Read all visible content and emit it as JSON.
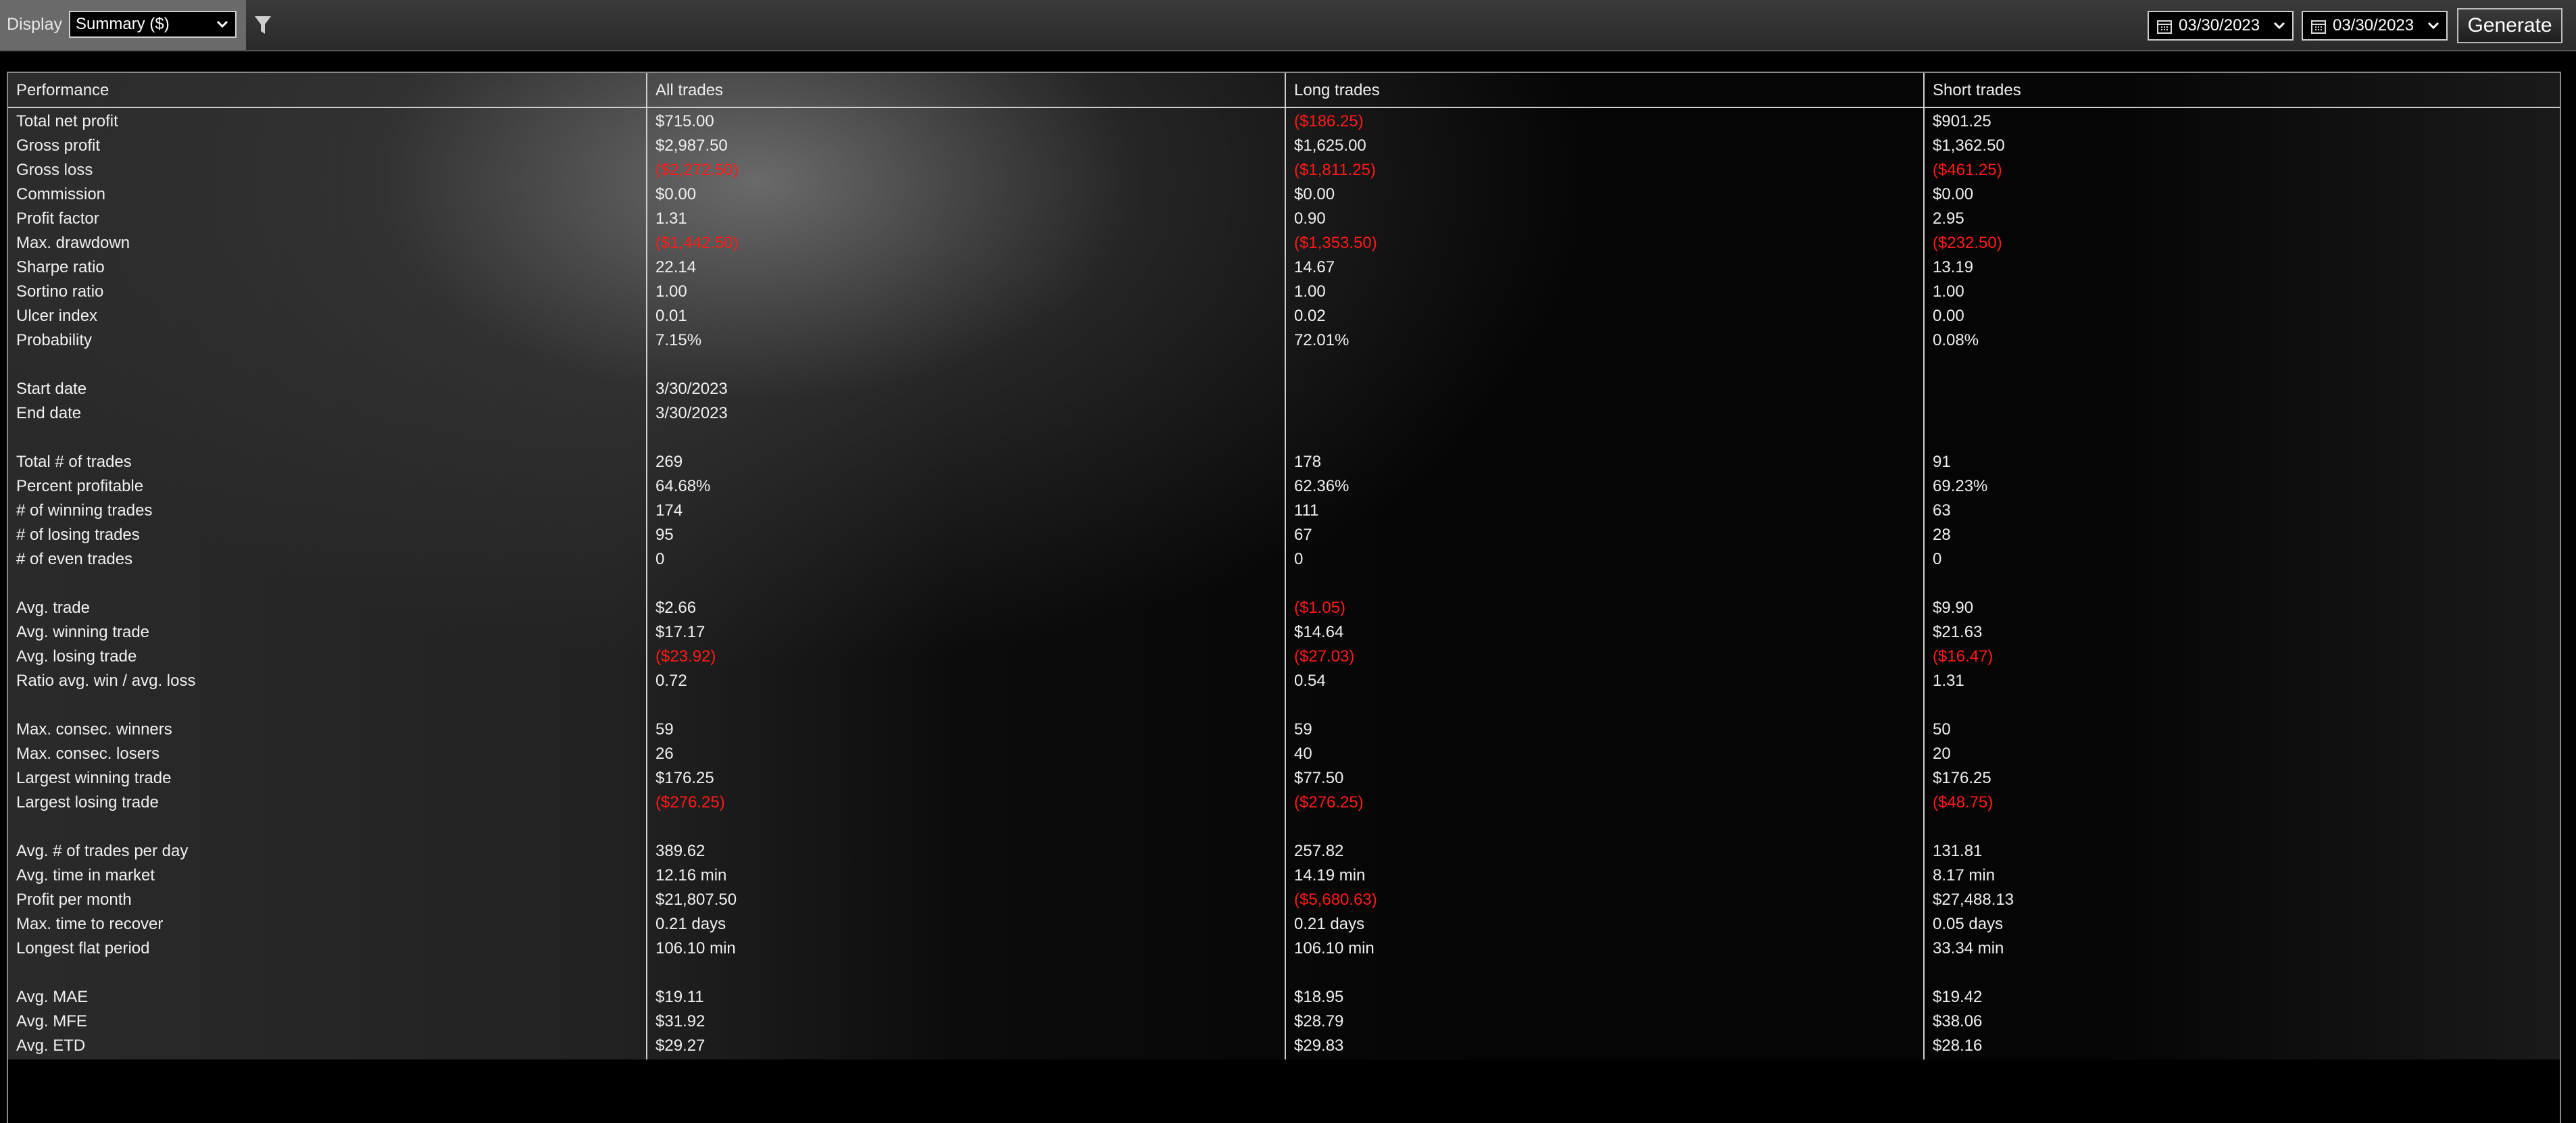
{
  "toolbar": {
    "display_label": "Display",
    "display_value": "Summary ($)",
    "date_from": "03/30/2023",
    "date_to": "03/30/2023",
    "generate_label": "Generate"
  },
  "colors": {
    "negative": "#ff1a1a",
    "text": "#f0f0f0",
    "grid": "#cfcfcf"
  },
  "table": {
    "headers": [
      "Performance",
      "All trades",
      "Long trades",
      "Short trades"
    ],
    "rows": [
      {
        "label": "Total net profit",
        "all": "$715.00",
        "long": "($186.25)",
        "short": "$901.25",
        "neg": [
          false,
          true,
          false
        ]
      },
      {
        "label": "Gross profit",
        "all": "$2,987.50",
        "long": "$1,625.00",
        "short": "$1,362.50",
        "neg": [
          false,
          false,
          false
        ]
      },
      {
        "label": "Gross loss",
        "all": "($2,272.50)",
        "long": "($1,811.25)",
        "short": "($461.25)",
        "neg": [
          true,
          true,
          true
        ]
      },
      {
        "label": "Commission",
        "all": "$0.00",
        "long": "$0.00",
        "short": "$0.00",
        "neg": [
          false,
          false,
          false
        ]
      },
      {
        "label": "Profit factor",
        "all": "1.31",
        "long": "0.90",
        "short": "2.95",
        "neg": [
          false,
          false,
          false
        ]
      },
      {
        "label": "Max. drawdown",
        "all": "($1,442.50)",
        "long": "($1,353.50)",
        "short": "($232.50)",
        "neg": [
          true,
          true,
          true
        ]
      },
      {
        "label": "Sharpe ratio",
        "all": "22.14",
        "long": "14.67",
        "short": "13.19",
        "neg": [
          false,
          false,
          false
        ]
      },
      {
        "label": "Sortino ratio",
        "all": "1.00",
        "long": "1.00",
        "short": "1.00",
        "neg": [
          false,
          false,
          false
        ]
      },
      {
        "label": "Ulcer index",
        "all": "0.01",
        "long": "0.02",
        "short": "0.00",
        "neg": [
          false,
          false,
          false
        ]
      },
      {
        "label": "Probability",
        "all": "7.15%",
        "long": "72.01%",
        "short": "0.08%",
        "neg": [
          false,
          false,
          false
        ]
      },
      {
        "spacer": true
      },
      {
        "label": "Start date",
        "all": "3/30/2023",
        "long": "",
        "short": "",
        "neg": [
          false,
          false,
          false
        ]
      },
      {
        "label": "End date",
        "all": "3/30/2023",
        "long": "",
        "short": "",
        "neg": [
          false,
          false,
          false
        ]
      },
      {
        "spacer": true
      },
      {
        "label": "Total # of trades",
        "all": "269",
        "long": "178",
        "short": "91",
        "neg": [
          false,
          false,
          false
        ]
      },
      {
        "label": "Percent profitable",
        "all": "64.68%",
        "long": "62.36%",
        "short": "69.23%",
        "neg": [
          false,
          false,
          false
        ]
      },
      {
        "label": "# of winning trades",
        "all": "174",
        "long": "111",
        "short": "63",
        "neg": [
          false,
          false,
          false
        ]
      },
      {
        "label": "# of losing trades",
        "all": "95",
        "long": "67",
        "short": "28",
        "neg": [
          false,
          false,
          false
        ]
      },
      {
        "label": "# of even trades",
        "all": "0",
        "long": "0",
        "short": "0",
        "neg": [
          false,
          false,
          false
        ]
      },
      {
        "spacer": true
      },
      {
        "label": "Avg. trade",
        "all": "$2.66",
        "long": "($1.05)",
        "short": "$9.90",
        "neg": [
          false,
          true,
          false
        ]
      },
      {
        "label": "Avg. winning trade",
        "all": "$17.17",
        "long": "$14.64",
        "short": "$21.63",
        "neg": [
          false,
          false,
          false
        ]
      },
      {
        "label": "Avg. losing trade",
        "all": "($23.92)",
        "long": "($27.03)",
        "short": "($16.47)",
        "neg": [
          true,
          true,
          true
        ]
      },
      {
        "label": "Ratio avg. win / avg. loss",
        "all": "0.72",
        "long": "0.54",
        "short": "1.31",
        "neg": [
          false,
          false,
          false
        ]
      },
      {
        "spacer": true
      },
      {
        "label": "Max. consec. winners",
        "all": "59",
        "long": "59",
        "short": "50",
        "neg": [
          false,
          false,
          false
        ]
      },
      {
        "label": "Max. consec. losers",
        "all": "26",
        "long": "40",
        "short": "20",
        "neg": [
          false,
          false,
          false
        ]
      },
      {
        "label": "Largest winning trade",
        "all": "$176.25",
        "long": "$77.50",
        "short": "$176.25",
        "neg": [
          false,
          false,
          false
        ]
      },
      {
        "label": "Largest losing trade",
        "all": "($276.25)",
        "long": "($276.25)",
        "short": "($48.75)",
        "neg": [
          true,
          true,
          true
        ]
      },
      {
        "spacer": true
      },
      {
        "label": "Avg. # of trades per day",
        "all": "389.62",
        "long": "257.82",
        "short": "131.81",
        "neg": [
          false,
          false,
          false
        ]
      },
      {
        "label": "Avg. time in market",
        "all": "12.16 min",
        "long": "14.19 min",
        "short": "8.17 min",
        "neg": [
          false,
          false,
          false
        ]
      },
      {
        "label": "Profit per month",
        "all": "$21,807.50",
        "long": "($5,680.63)",
        "short": "$27,488.13",
        "neg": [
          false,
          true,
          false
        ]
      },
      {
        "label": "Max. time to recover",
        "all": "0.21 days",
        "long": "0.21 days",
        "short": "0.05 days",
        "neg": [
          false,
          false,
          false
        ]
      },
      {
        "label": "Longest flat period",
        "all": "106.10 min",
        "long": "106.10 min",
        "short": "33.34 min",
        "neg": [
          false,
          false,
          false
        ]
      },
      {
        "spacer": true
      },
      {
        "label": "Avg. MAE",
        "all": "$19.11",
        "long": "$18.95",
        "short": "$19.42",
        "neg": [
          false,
          false,
          false
        ]
      },
      {
        "label": "Avg. MFE",
        "all": "$31.92",
        "long": "$28.79",
        "short": "$38.06",
        "neg": [
          false,
          false,
          false
        ]
      },
      {
        "label": "Avg. ETD",
        "all": "$29.27",
        "long": "$29.83",
        "short": "$28.16",
        "neg": [
          false,
          false,
          false
        ]
      }
    ]
  }
}
